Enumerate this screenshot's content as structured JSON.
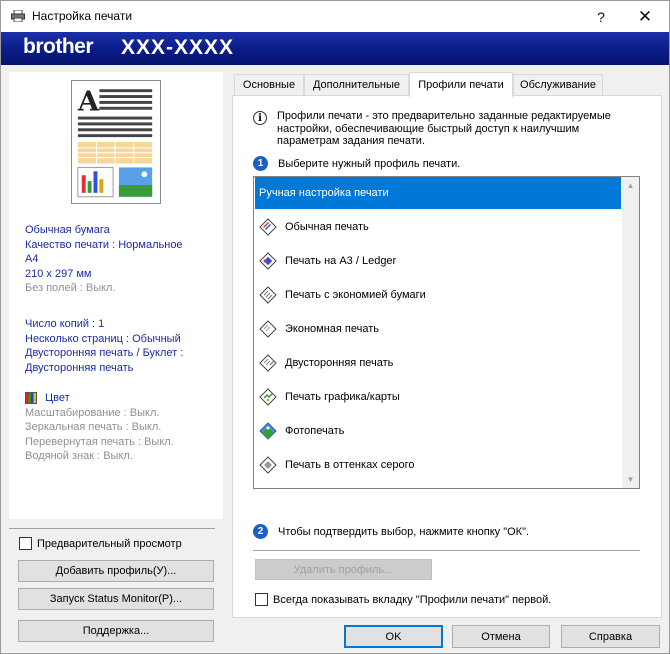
{
  "window": {
    "title": "Настройка печати",
    "help_glyph": "?",
    "close_glyph": "✕",
    "title_icon": "printer-icon"
  },
  "banner": {
    "logo": "brother",
    "model": "XXX-XXXX"
  },
  "summary": {
    "paper_type": "Обычная бумага",
    "quality": "Качество печати : Нормальное",
    "paper_size": "A4",
    "dimensions": "210 x 297 мм",
    "borderless": "Без полей : Выкл.",
    "copies": "Число копий : 1",
    "multipage": "Несколько страниц : Обычный",
    "duplex_label": "Двусторонняя печать / Буклет :",
    "duplex_value": "Двусторонняя печать",
    "color": "Цвет",
    "scaling": "Масштабирование : Выкл.",
    "mirror": "Зеркальная печать : Выкл.",
    "reverse": "Перевернутая печать : Выкл.",
    "watermark": "Водяной знак : Выкл."
  },
  "left": {
    "preview_checkbox": "Предварительный просмотр",
    "add_profile": "Добавить профиль(У)...",
    "status_monitor": "Запуск Status Monitor(P)...",
    "support": "Поддержка..."
  },
  "tabs": [
    {
      "label": "Основные"
    },
    {
      "label": "Дополнительные"
    },
    {
      "label": "Профили печати"
    },
    {
      "label": "Обслуживание"
    }
  ],
  "content": {
    "info_line1": "Профили печати - это предварительно заданные редактируемые",
    "info_line2": "настройки, обеспечивающие быстрый доступ к наилучшим",
    "info_line3": "параметрам задания печати.",
    "step1_num": "1",
    "step1_text": "Выберите нужный профиль печати.",
    "step2_num": "2",
    "step2_text": "Чтобы подтвердить выбор, нажмите кнопку \"ОК\".",
    "delete_profile": "Удалить профиль...",
    "always_show": "Всегда показывать вкладку \"Профили печати\" первой."
  },
  "profiles": [
    {
      "label": "Ручная настройка печати",
      "selected": true
    },
    {
      "label": "Обычная печать",
      "icon": "normal-print-icon"
    },
    {
      "label": "Печать на A3 / Ledger",
      "icon": "a3-ledger-icon"
    },
    {
      "label": "Печать с экономией бумаги",
      "icon": "paper-save-icon"
    },
    {
      "label": "Экономная печать",
      "icon": "eco-print-icon"
    },
    {
      "label": "Двусторонняя печать",
      "icon": "duplex-print-icon"
    },
    {
      "label": "Печать графика/карты",
      "icon": "chart-map-icon"
    },
    {
      "label": "Фотопечать",
      "icon": "photo-print-icon"
    },
    {
      "label": "Печать в оттенках серого",
      "icon": "grayscale-icon"
    }
  ],
  "footer": {
    "ok": "OK",
    "cancel": "Отмена",
    "help": "Справка"
  }
}
